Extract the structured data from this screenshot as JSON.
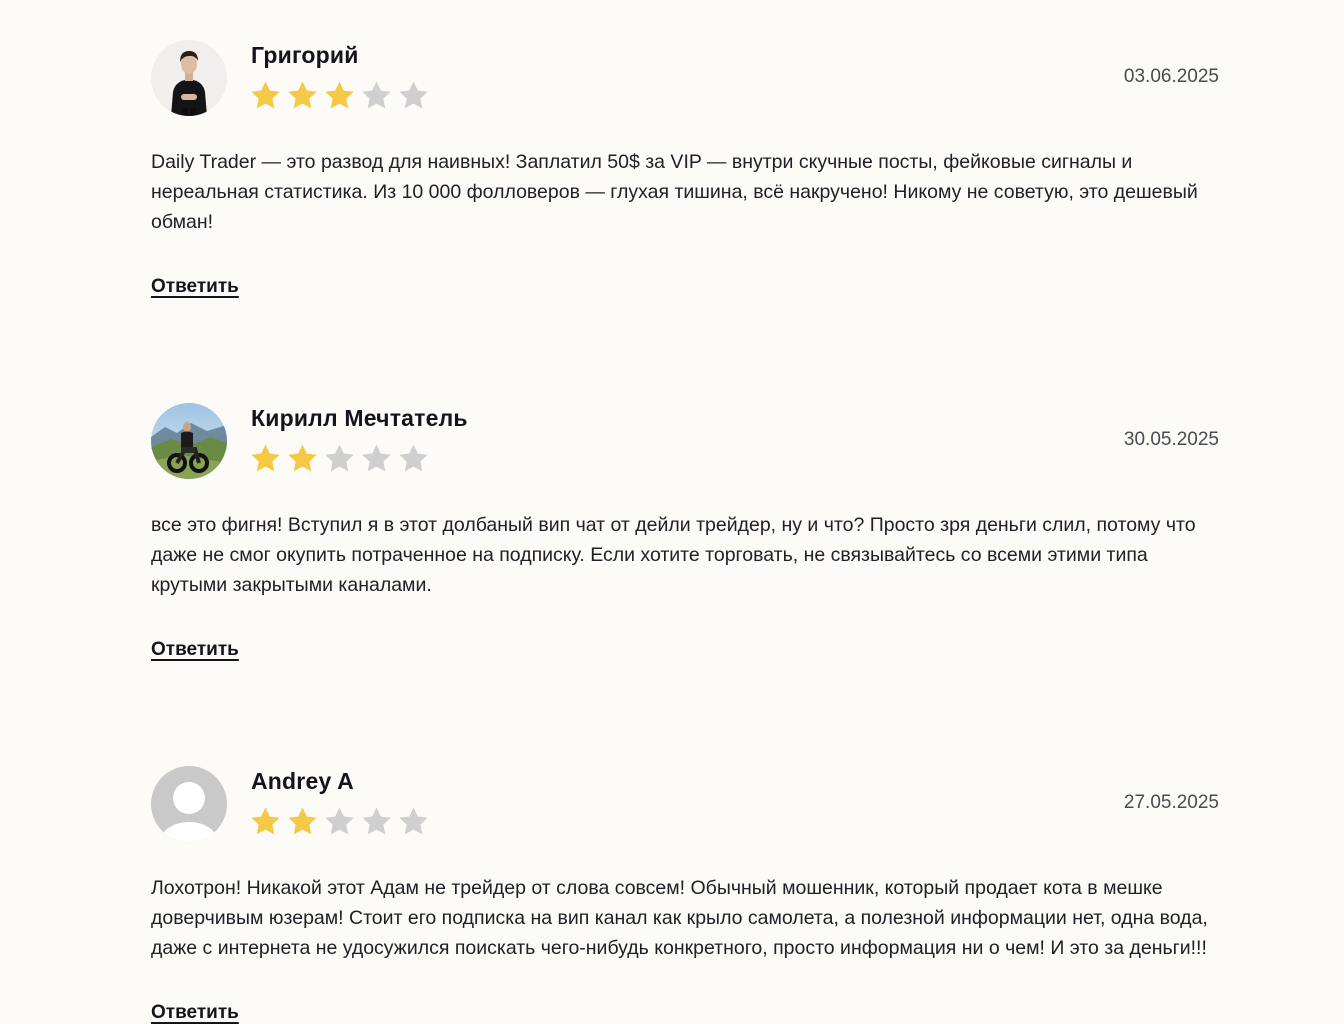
{
  "reviews": [
    {
      "author": "Григорий",
      "avatar_icon": "user-photo-man-black-sweater",
      "rating": 3,
      "max_rating": 5,
      "date": "03.06.2025",
      "text": "Daily Trader — это развод для наивных! Заплатил 50$ за VIP — внутри скучные посты, фейковые сигналы и нереальная статистика. Из 10 000 фолловеров — глухая тишина, всё накручено! Никому не советую, это дешевый обман!",
      "reply_label": "Ответить"
    },
    {
      "author": "Кирилл Мечтатель",
      "avatar_icon": "user-photo-motorcycle-mountains",
      "rating": 2,
      "max_rating": 5,
      "date": "30.05.2025",
      "text": "все это фигня! Вступил я в этот долбаный вип чат от дейли трейдер, ну и что? Просто зря деньги слил, потому что даже не смог окупить потраченное на подписку. Если хотите торговать, не связывайтесь со всеми этими типа крутыми закрытыми каналами.",
      "reply_label": "Ответить"
    },
    {
      "author": "Andrey A",
      "avatar_icon": "default-user-icon",
      "rating": 2,
      "max_rating": 5,
      "date": "27.05.2025",
      "text": "Лохотрон! Никакой этот Адам не трейдер от слова совсем! Обычный мошенник, который продает кота в мешке доверчивым юзерам! Стоит его подписка на вип канал как крыло самолета, а полезной информации нет, одна вода, даже с интернета не удосужился поискать чего-нибудь конкретного, просто информация ни о чем! И это за деньги!!!",
      "reply_label": "Ответить"
    }
  ],
  "colors": {
    "background": "#fdfbf8",
    "star_filled": "#f5c945",
    "star_empty": "#cfcfcf",
    "text": "#202026"
  }
}
